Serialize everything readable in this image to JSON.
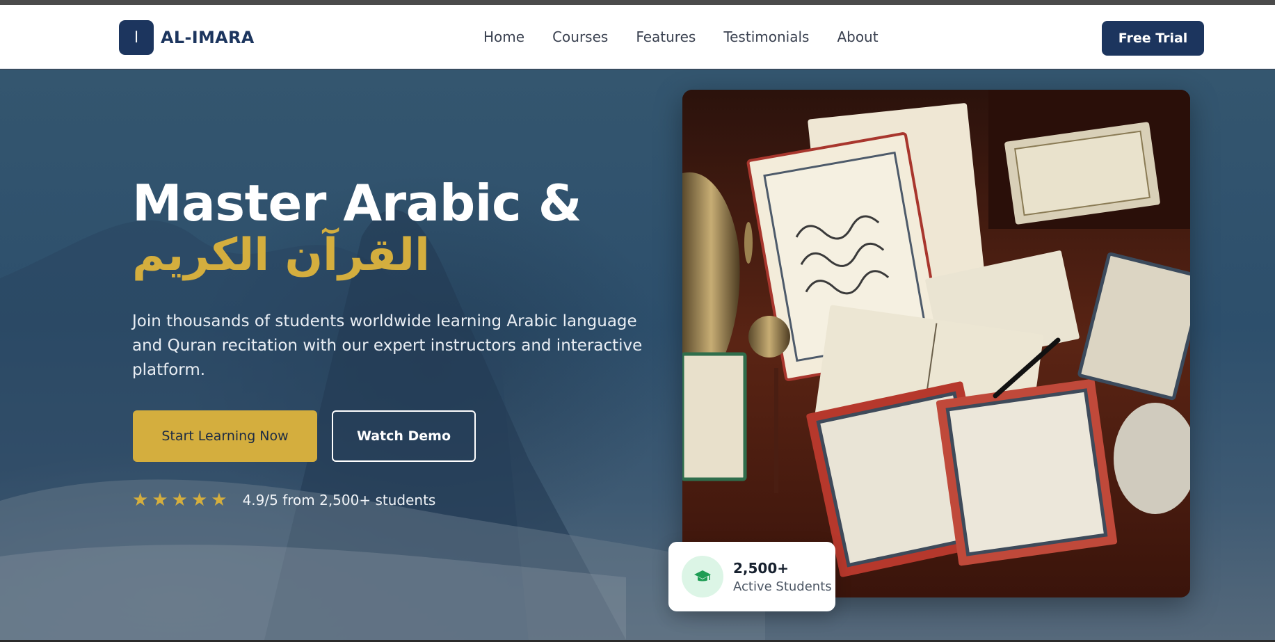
{
  "brand": {
    "mark": "ا",
    "name": "AL-IMARA"
  },
  "nav": {
    "items": [
      "Home",
      "Courses",
      "Features",
      "Testimonials",
      "About"
    ]
  },
  "header": {
    "cta_label": "Free Trial"
  },
  "hero": {
    "title_line1": "Master Arabic &",
    "title_line2": "القرآن الكريم",
    "subtitle": "Join thousands of students worldwide learning Arabic language and Quran recitation with our expert instructors and interactive platform.",
    "primary_button": "Start Learning Now",
    "secondary_button": "Watch Demo",
    "rating": {
      "stars": 5,
      "text": "4.9/5 from 2,500+ students"
    }
  },
  "stat_card": {
    "icon": "graduation-cap-icon",
    "value": "2,500+",
    "label": "Active Students"
  },
  "colors": {
    "brand_navy": "#1c355e",
    "accent_gold": "#d4ae3e",
    "hero_bg": "#2d4f6c",
    "stat_icon_bg": "#dcf5e6",
    "stat_icon": "#1f9d55"
  }
}
